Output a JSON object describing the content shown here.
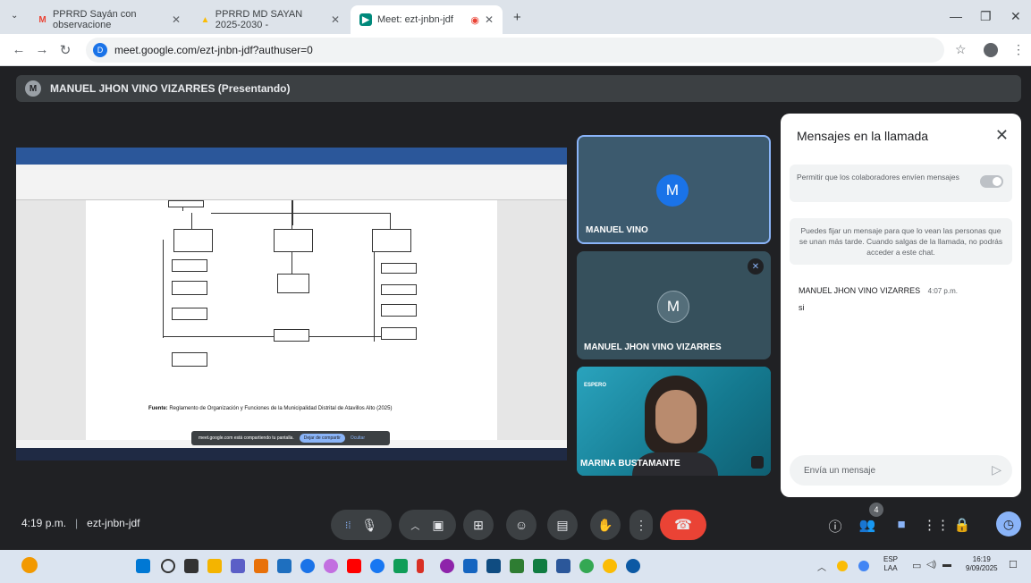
{
  "browser": {
    "tabs": [
      {
        "label": "PPRRD Sayán con observacione",
        "icon": "gmail-icon"
      },
      {
        "label": "PPRRD MD SAYAN 2025-2030 -",
        "icon": "drive-icon"
      },
      {
        "label": "Meet: ezt-jnbn-jdf",
        "icon": "meet-icon"
      }
    ],
    "url": "meet.google.com/ezt-jnbn-jdf?authuser=0"
  },
  "presenter": {
    "initial": "M",
    "label": "MANUEL JHON VINO VIZARRES (Presentando)"
  },
  "shared_screen": {
    "caption_bold": "Fuente:",
    "caption": "Reglamento de Organización y Funciones de la Municipalidad Distrital de Atavillos Alto (2025)",
    "share_notice": "meet.google.com está compartiendo tu pantalla.",
    "stop_label": "Dejar de compartir",
    "hide_label": "Ocultar"
  },
  "participants": [
    {
      "name": "MANUEL VINO",
      "initial": "M",
      "color": "#1a73e8"
    },
    {
      "name": "MANUEL JHON VINO VIZARRES",
      "initial": "M",
      "color": "#546e7a"
    },
    {
      "name": "MARINA BUSTAMANTE",
      "brand": "ESPERO"
    }
  ],
  "chat": {
    "title": "Mensajes en la llamada",
    "allow_label": "Permitir que los colaboradores envíen mensajes",
    "pin_info": "Puedes fijar un mensaje para que lo vean las personas que se unan más tarde. Cuando salgas de la llamada, no podrás acceder a este chat.",
    "messages": [
      {
        "sender": "MANUEL JHON VINO VIZARRES",
        "time": "4:07 p.m.",
        "text": "si"
      }
    ],
    "input_placeholder": "Envía un mensaje"
  },
  "meeting": {
    "time": "4:19 p.m.",
    "code": "ezt-jnbn-jdf",
    "participant_count": "4"
  },
  "taskbar": {
    "lang": "ESP",
    "layout": "LAA",
    "time": "16:19",
    "date": "9/09/2025"
  },
  "colors": {
    "meet_bg": "#202124",
    "end_call": "#ea4335",
    "accent": "#8ab4f8",
    "word_blue": "#2b579a"
  }
}
